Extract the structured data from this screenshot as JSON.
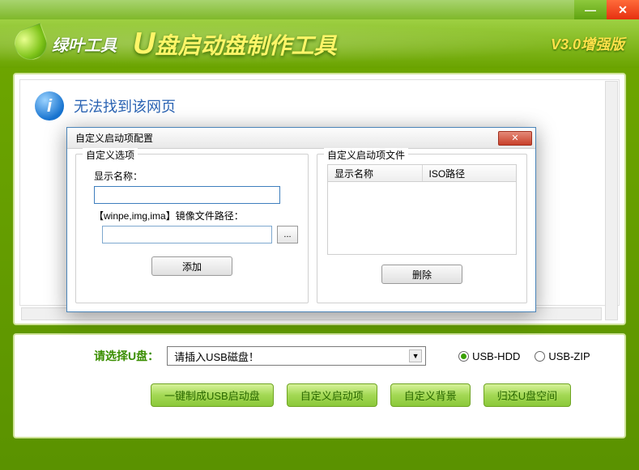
{
  "header": {
    "brand": "绿叶工具",
    "title_u": "U",
    "title_rest": "盘启动盘制作工具",
    "version": "V3.0增强版"
  },
  "main": {
    "error_text": "无法找到该网页"
  },
  "dialog": {
    "title": "自定义启动项配置",
    "left_legend": "自定义选项",
    "name_label": "显示名称：",
    "path_label": "【winpe,img,ima】镜像文件路径：",
    "browse": "...",
    "add_btn": "添加",
    "right_legend": "自定义启动项文件",
    "col1": "显示名称",
    "col2": "ISO路径",
    "del_btn": "删除"
  },
  "bottom": {
    "select_label": "请选择U盘：",
    "select_value": "请插入USB磁盘！",
    "radio1": "USB-HDD",
    "radio2": "USB-ZIP",
    "btn1": "一键制成USB启动盘",
    "btn2": "自定义启动项",
    "btn3": "自定义背景",
    "btn4": "归还U盘空间"
  }
}
